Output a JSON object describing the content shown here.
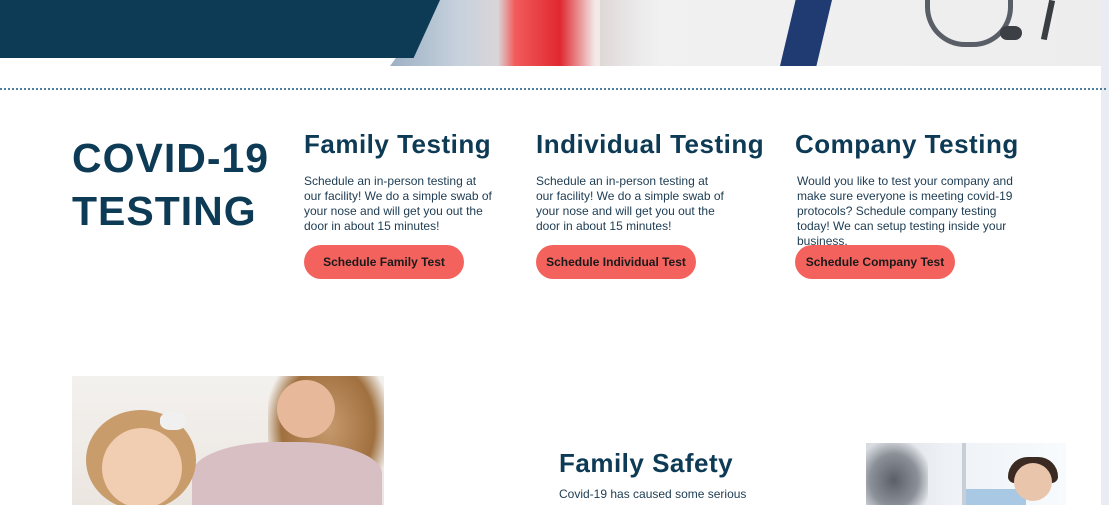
{
  "hero": {
    "navy": "#0d3a55",
    "image": "doctor-stethoscope-photo"
  },
  "testing": {
    "title_line1": "COVID-19",
    "title_line2": "TESTING",
    "columns": [
      {
        "title": "Family Testing",
        "description": "Schedule an in-person testing at our facility! We do a simple swab of your nose and will get you out the door in about 15 minutes!",
        "button": "Schedule Family Test"
      },
      {
        "title": "Individual Testing",
        "description": "Schedule an in-person testing at our facility! We do a simple swab of your nose and will get you out the door in about 15 minutes!",
        "button": "Schedule Individual Test"
      },
      {
        "title": "Company Testing",
        "description": "Would you like to test your company and make sure everyone is meeting covid-19 protocols? Schedule company testing today! We can setup testing inside your business.",
        "button": "Schedule Company Test"
      }
    ]
  },
  "safety": {
    "title": "Family Safety",
    "text": "Covid-19 has caused some serious"
  },
  "colors": {
    "accent": "#f4625d",
    "heading": "#0d3a55"
  }
}
